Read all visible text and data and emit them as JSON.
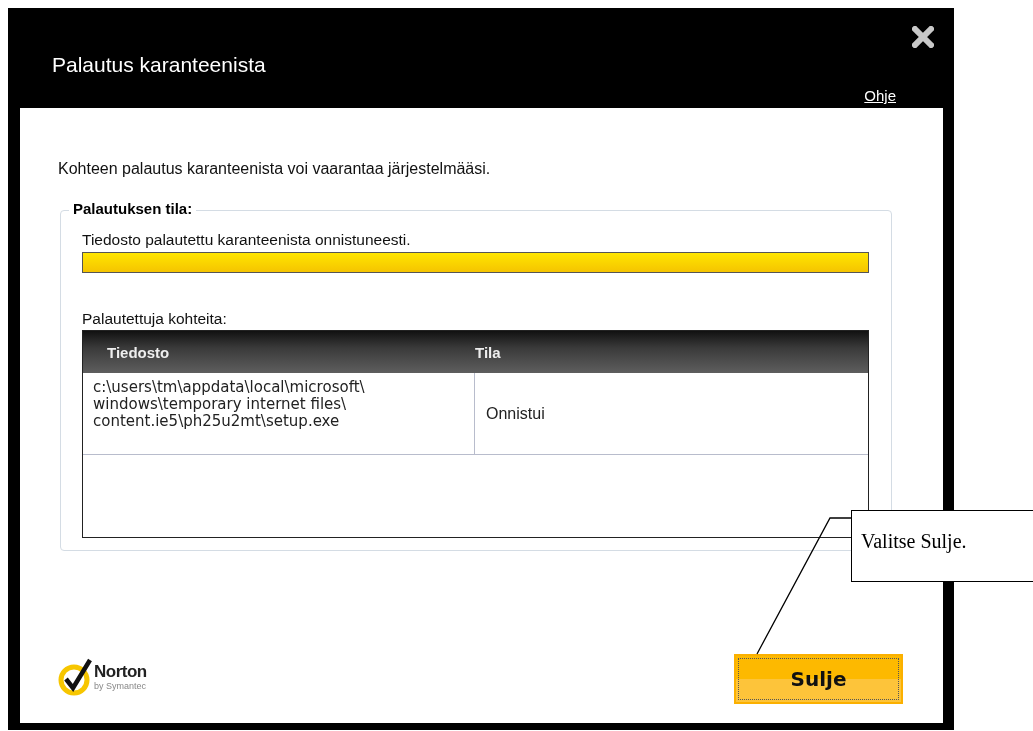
{
  "window": {
    "title": "Palautus karanteenista",
    "help_link": "Ohje"
  },
  "message": "Kohteen palautus karanteenista voi vaarantaa järjestelmääsi.",
  "status_group": {
    "legend": "Palautuksen tila:",
    "status_text": "Tiedosto palautettu karanteenista onnistuneesti.",
    "progress": {
      "level": 1
    }
  },
  "items": {
    "label": "Palautettuja kohteita:",
    "columns": [
      "Tiedosto",
      "Tila"
    ],
    "rows": [
      {
        "file": "c:\\users\\tm\\appdata\\local\\microsoft\\windows\\temporary internet files\\content.ie5\\ph25u2mt\\setup.exe",
        "status": "Onnistui"
      }
    ]
  },
  "logo": {
    "name": "Norton",
    "tagline": "by Symantec"
  },
  "buttons": [
    {
      "label": "Sulje"
    }
  ],
  "callout": {
    "text": "Valitse Sulje."
  }
}
